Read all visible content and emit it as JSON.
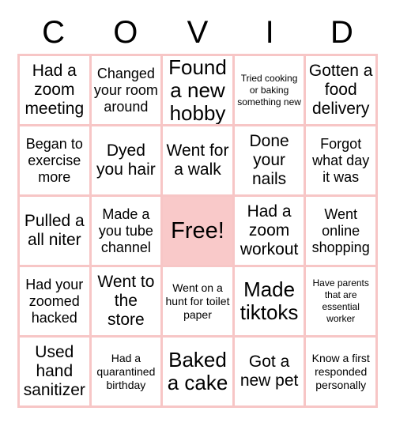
{
  "header": {
    "letters": [
      "C",
      "O",
      "V",
      "I",
      "D"
    ]
  },
  "grid": {
    "rows": [
      [
        {
          "text": "Had a zoom meeting",
          "size": "lg",
          "free": false
        },
        {
          "text": "Changed your room around",
          "size": "md",
          "free": false
        },
        {
          "text": "Found a new hobby",
          "size": "xl",
          "free": false
        },
        {
          "text": "Tried cooking or baking something new",
          "size": "xs",
          "free": false
        },
        {
          "text": "Gotten a food delivery",
          "size": "lg",
          "free": false
        }
      ],
      [
        {
          "text": "Began to exercise more",
          "size": "md",
          "free": false
        },
        {
          "text": "Dyed you hair",
          "size": "lg",
          "free": false
        },
        {
          "text": "Went for a walk",
          "size": "lg",
          "free": false
        },
        {
          "text": "Done your nails",
          "size": "lg",
          "free": false
        },
        {
          "text": "Forgot what day it was",
          "size": "md",
          "free": false
        }
      ],
      [
        {
          "text": "Pulled a all niter",
          "size": "lg",
          "free": false
        },
        {
          "text": "Made a you tube channel",
          "size": "md",
          "free": false
        },
        {
          "text": "Free!",
          "size": "xl",
          "free": true
        },
        {
          "text": "Had a zoom workout",
          "size": "lg",
          "free": false
        },
        {
          "text": "Went online shopping",
          "size": "md",
          "free": false
        }
      ],
      [
        {
          "text": "Had your zoomed hacked",
          "size": "md",
          "free": false
        },
        {
          "text": "Went to the store",
          "size": "lg",
          "free": false
        },
        {
          "text": "Went on a hunt for toilet paper",
          "size": "sm",
          "free": false
        },
        {
          "text": "Made tiktoks",
          "size": "xl",
          "free": false
        },
        {
          "text": "Have parents that are essential worker",
          "size": "xs",
          "free": false
        }
      ],
      [
        {
          "text": "Used hand sanitizer",
          "size": "lg",
          "free": false
        },
        {
          "text": "Had a quarantined birthday",
          "size": "sm",
          "free": false
        },
        {
          "text": "Baked a cake",
          "size": "xl",
          "free": false
        },
        {
          "text": "Got a new pet",
          "size": "lg",
          "free": false
        },
        {
          "text": "Know a first responded personally",
          "size": "sm",
          "free": false
        }
      ]
    ]
  },
  "colors": {
    "grid_border": "#f7c6c6",
    "free_cell_background": "#f9c9c9",
    "text": "#000000",
    "page_background": "#ffffff"
  }
}
